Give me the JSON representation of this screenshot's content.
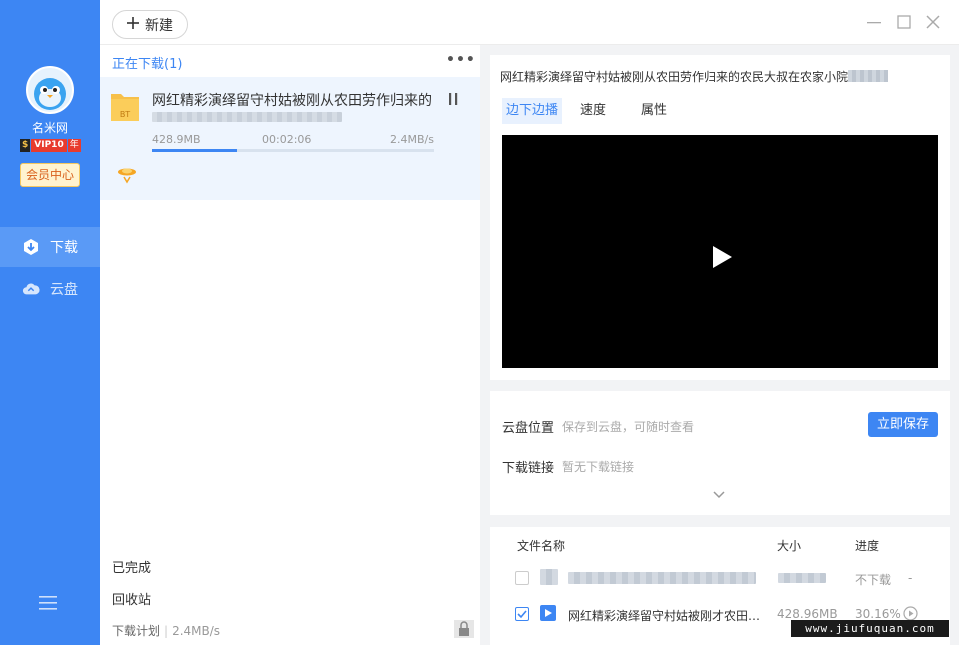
{
  "sidebar": {
    "username": "名米网",
    "vip": {
      "s": "$",
      "v": "VIP10",
      "y": "年"
    },
    "member_center": "会员中心",
    "nav": [
      {
        "label": "下载",
        "active": true
      },
      {
        "label": "云盘",
        "active": false
      }
    ]
  },
  "toolbar": {
    "new_label": "新建"
  },
  "downloads": {
    "header": "正在下载(1)",
    "item": {
      "name": "网红精彩演绎留守村姑被刚从农田劳作归来的农",
      "file_type": "BT",
      "size": "428.9MB",
      "time": "00:02:06",
      "speed": "2.4MB/s",
      "progress": 0.3
    },
    "completed": "已完成",
    "recycle": "回收站",
    "plan_label": "下载计划",
    "plan_speed": "2.4MB/s"
  },
  "detail": {
    "title": "网红精彩演绎留守村姑被刚从农田劳作归来的农民大叔在农家小院",
    "tabs": [
      "边下边播",
      "速度",
      "属性"
    ],
    "cloud_label": "云盘位置",
    "cloud_hint": "保存到云盘，可随时查看",
    "save_btn": "立即保存",
    "link_label": "下载链接",
    "link_hint": "暂无下载链接"
  },
  "files": {
    "headers": {
      "name": "文件名称",
      "size": "大小",
      "progress": "进度"
    },
    "rows": [
      {
        "status": "不下载",
        "extra": "-"
      },
      {
        "name": "网红精彩演绎留守村姑被刚才农田劳...",
        "size": "428.96MB",
        "progress": "30.16%"
      }
    ]
  },
  "watermark": "www.jiufuquan.com",
  "colors": {
    "accent": "#3d86f3",
    "sidebar": "#3d86f3",
    "vip": "#e83b2e"
  }
}
